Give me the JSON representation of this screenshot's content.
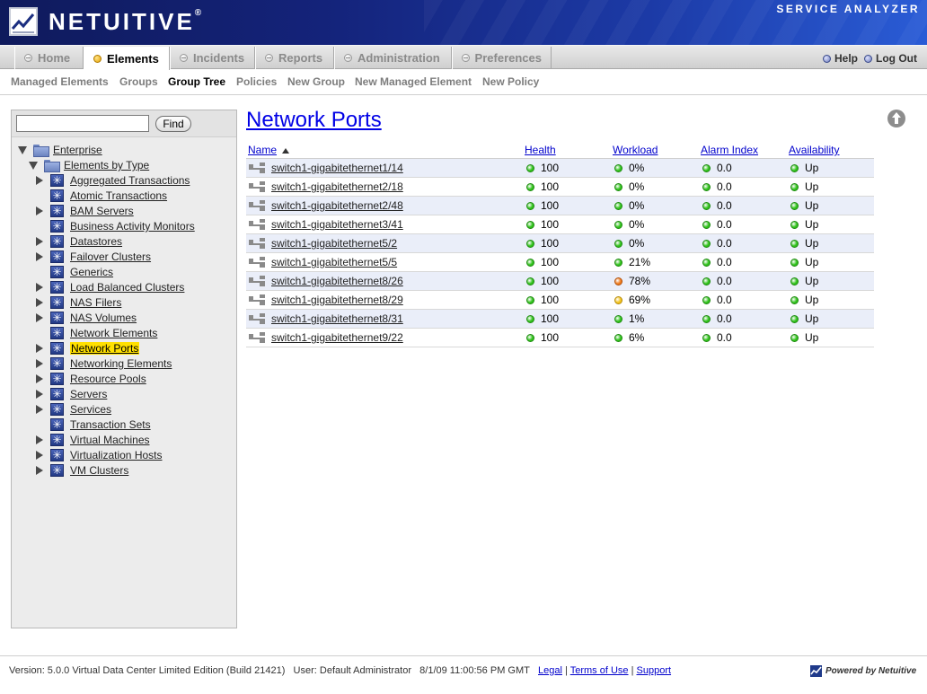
{
  "header": {
    "brand": "NETUITIVE",
    "brand_mark": "®",
    "product": "SERVICE ANALYZER"
  },
  "tabs": [
    {
      "label": "Home",
      "active": false
    },
    {
      "label": "Elements",
      "active": true
    },
    {
      "label": "Incidents",
      "active": false
    },
    {
      "label": "Reports",
      "active": false
    },
    {
      "label": "Administration",
      "active": false
    },
    {
      "label": "Preferences",
      "active": false
    }
  ],
  "toplinks": {
    "help": "Help",
    "logout": "Log Out"
  },
  "subnav": [
    {
      "label": "Managed Elements",
      "active": false
    },
    {
      "label": "Groups",
      "active": false
    },
    {
      "label": "Group Tree",
      "active": true
    },
    {
      "label": "Policies",
      "active": false
    },
    {
      "label": "New Group",
      "active": false
    },
    {
      "label": "New Managed Element",
      "active": false
    },
    {
      "label": "New Policy",
      "active": false
    }
  ],
  "sidebar": {
    "search_value": "",
    "find_label": "Find",
    "tree": [
      {
        "label": "Enterprise",
        "level": 0,
        "expander": "down",
        "icon": "folder-icon"
      },
      {
        "label": "Elements by Type",
        "level": 1,
        "expander": "down",
        "icon": "folder-icon"
      },
      {
        "label": "Aggregated Transactions",
        "level": 2,
        "expander": "right",
        "icon": "element-type-icon"
      },
      {
        "label": "Atomic Transactions",
        "level": 2,
        "expander": "none",
        "icon": "element-type-icon"
      },
      {
        "label": "BAM Servers",
        "level": 2,
        "expander": "right",
        "icon": "element-type-icon"
      },
      {
        "label": "Business Activity Monitors",
        "level": 2,
        "expander": "none",
        "icon": "element-type-icon"
      },
      {
        "label": "Datastores",
        "level": 2,
        "expander": "right",
        "icon": "element-type-icon"
      },
      {
        "label": "Failover Clusters",
        "level": 2,
        "expander": "right",
        "icon": "element-type-icon"
      },
      {
        "label": "Generics",
        "level": 2,
        "expander": "none",
        "icon": "element-type-icon"
      },
      {
        "label": "Load Balanced Clusters",
        "level": 2,
        "expander": "right",
        "icon": "element-type-icon"
      },
      {
        "label": "NAS Filers",
        "level": 2,
        "expander": "right",
        "icon": "element-type-icon"
      },
      {
        "label": "NAS Volumes",
        "level": 2,
        "expander": "right",
        "icon": "element-type-icon"
      },
      {
        "label": "Network Elements",
        "level": 2,
        "expander": "none",
        "icon": "element-type-icon"
      },
      {
        "label": "Network Ports",
        "level": 2,
        "expander": "right",
        "icon": "element-type-icon",
        "selected": true
      },
      {
        "label": "Networking Elements",
        "level": 2,
        "expander": "right",
        "icon": "element-type-icon"
      },
      {
        "label": "Resource Pools",
        "level": 2,
        "expander": "right",
        "icon": "element-type-icon"
      },
      {
        "label": "Servers",
        "level": 2,
        "expander": "right",
        "icon": "element-type-icon"
      },
      {
        "label": "Services",
        "level": 2,
        "expander": "right",
        "icon": "element-type-icon"
      },
      {
        "label": "Transaction Sets",
        "level": 2,
        "expander": "none",
        "icon": "element-type-icon"
      },
      {
        "label": "Virtual Machines",
        "level": 2,
        "expander": "right",
        "icon": "element-type-icon"
      },
      {
        "label": "Virtualization Hosts",
        "level": 2,
        "expander": "right",
        "icon": "element-type-icon"
      },
      {
        "label": "VM Clusters",
        "level": 2,
        "expander": "right",
        "icon": "element-type-icon"
      }
    ]
  },
  "main": {
    "title": "Network Ports",
    "columns": [
      "Name",
      "Health",
      "Workload",
      "Alarm Index",
      "Availability"
    ],
    "sort_column": "Name",
    "sort_direction": "ascending",
    "rows": [
      {
        "name": "switch1-gigabitethernet1/14",
        "health": "100",
        "health_status": "green",
        "workload": "0%",
        "workload_status": "green",
        "alarm": "0.0",
        "alarm_status": "green",
        "availability": "Up",
        "availability_status": "green"
      },
      {
        "name": "switch1-gigabitethernet2/18",
        "health": "100",
        "health_status": "green",
        "workload": "0%",
        "workload_status": "green",
        "alarm": "0.0",
        "alarm_status": "green",
        "availability": "Up",
        "availability_status": "green"
      },
      {
        "name": "switch1-gigabitethernet2/48",
        "health": "100",
        "health_status": "green",
        "workload": "0%",
        "workload_status": "green",
        "alarm": "0.0",
        "alarm_status": "green",
        "availability": "Up",
        "availability_status": "green"
      },
      {
        "name": "switch1-gigabitethernet3/41",
        "health": "100",
        "health_status": "green",
        "workload": "0%",
        "workload_status": "green",
        "alarm": "0.0",
        "alarm_status": "green",
        "availability": "Up",
        "availability_status": "green"
      },
      {
        "name": "switch1-gigabitethernet5/2",
        "health": "100",
        "health_status": "green",
        "workload": "0%",
        "workload_status": "green",
        "alarm": "0.0",
        "alarm_status": "green",
        "availability": "Up",
        "availability_status": "green"
      },
      {
        "name": "switch1-gigabitethernet5/5",
        "health": "100",
        "health_status": "green",
        "workload": "21%",
        "workload_status": "green",
        "alarm": "0.0",
        "alarm_status": "green",
        "availability": "Up",
        "availability_status": "green"
      },
      {
        "name": "switch1-gigabitethernet8/26",
        "health": "100",
        "health_status": "green",
        "workload": "78%",
        "workload_status": "orange",
        "alarm": "0.0",
        "alarm_status": "green",
        "availability": "Up",
        "availability_status": "green"
      },
      {
        "name": "switch1-gigabitethernet8/29",
        "health": "100",
        "health_status": "green",
        "workload": "69%",
        "workload_status": "yellow",
        "alarm": "0.0",
        "alarm_status": "green",
        "availability": "Up",
        "availability_status": "green"
      },
      {
        "name": "switch1-gigabitethernet8/31",
        "health": "100",
        "health_status": "green",
        "workload": "1%",
        "workload_status": "green",
        "alarm": "0.0",
        "alarm_status": "green",
        "availability": "Up",
        "availability_status": "green"
      },
      {
        "name": "switch1-gigabitethernet9/22",
        "health": "100",
        "health_status": "green",
        "workload": "6%",
        "workload_status": "green",
        "alarm": "0.0",
        "alarm_status": "green",
        "availability": "Up",
        "availability_status": "green"
      }
    ]
  },
  "footer": {
    "version_text": "Version: 5.0.0 Virtual Data Center Limited Edition (Build 21421)",
    "user_text": "User: Default Administrator",
    "timestamp": "8/1/09 11:00:56 PM GMT",
    "legal": "Legal",
    "terms": "Terms of Use",
    "support": "Support",
    "powered_by": "Powered by Netuitive"
  },
  "colors": {
    "status_green": "#2fc21a",
    "status_orange": "#ee7a1c",
    "status_yellow": "#f2c21c",
    "link_blue": "#0000cc",
    "header_navy": "#14237a",
    "selected_highlight": "#ffe000",
    "row_alt": "#eaeef9"
  }
}
